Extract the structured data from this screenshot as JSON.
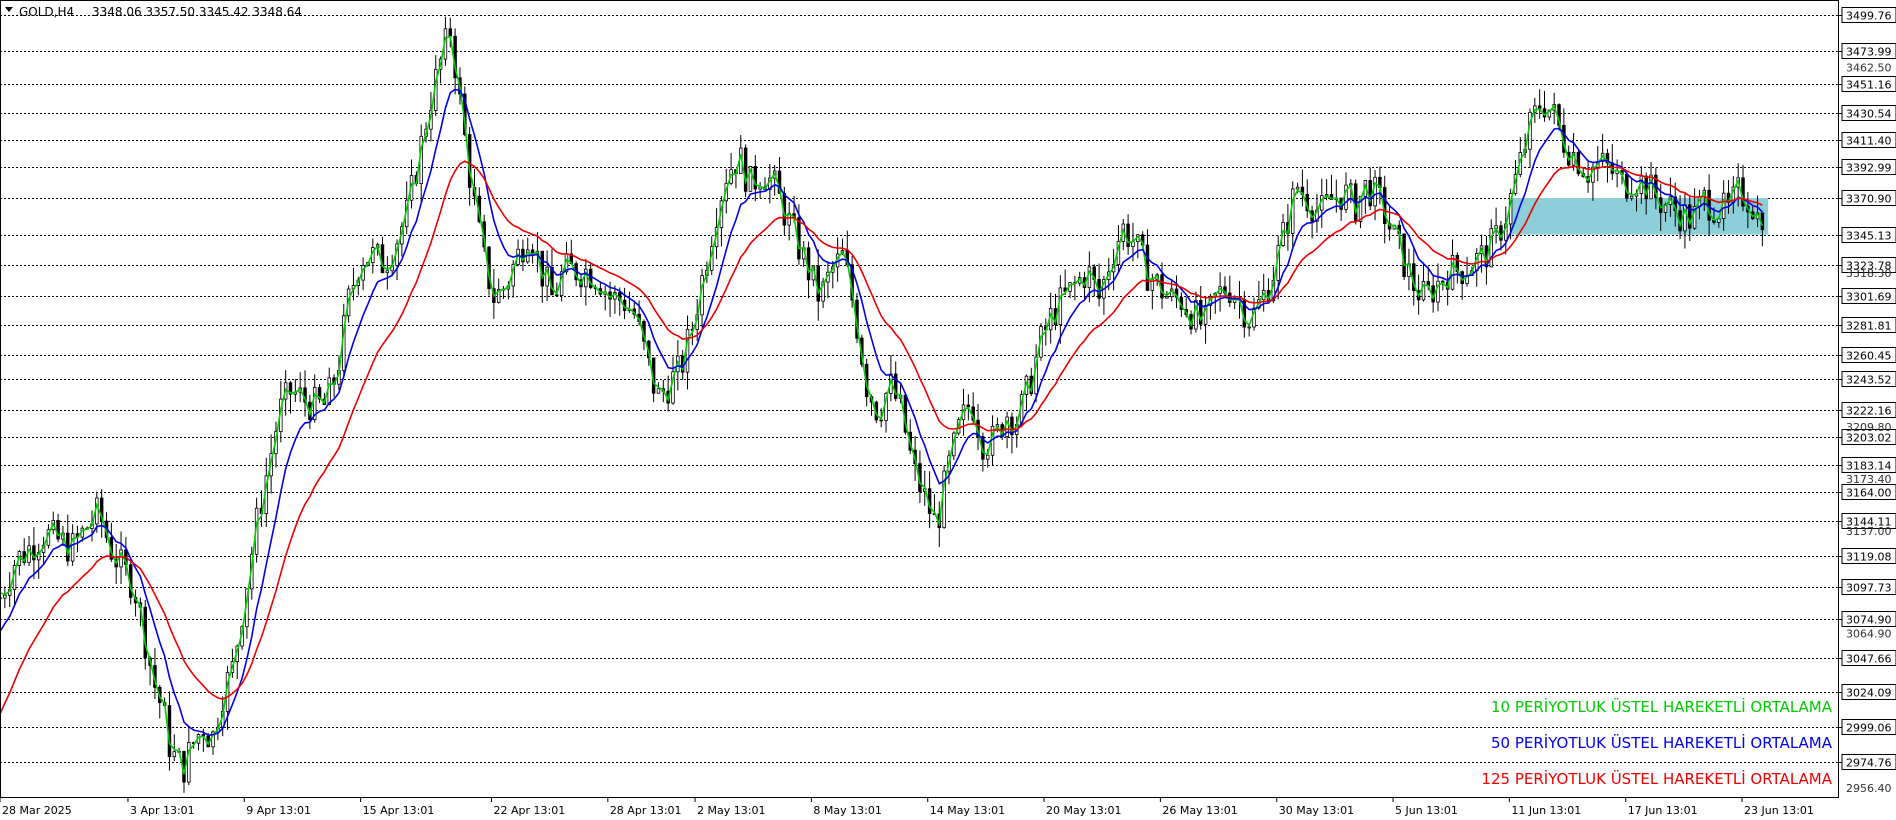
{
  "header": {
    "symbol": "GOLD,H4",
    "ohlc": "3348.06 3357.50 3345.42 3348.64"
  },
  "legend": [
    {
      "label": "10 PERİYOTLUK ÜSTEL HAREKETLİ ORTALAMA",
      "color": "#00cc00"
    },
    {
      "label": "50 PERİYOTLUK ÜSTEL HAREKETLİ ORTALAMA",
      "color": "#0000ee"
    },
    {
      "label": "125 PERİYOTLUK ÜSTEL HAREKETLİ ORTALAMA",
      "color": "#ee0000"
    }
  ],
  "colors": {
    "candle": "#000000",
    "grid": "#000000",
    "zone_fill": "#8ccfd8",
    "ema10": "#00cc00",
    "ema50": "#0000ee",
    "ema125": "#ee0000",
    "price_label_fill": "#ffffff"
  },
  "chart_data": {
    "type": "candlestick",
    "instrument": "GOLD",
    "timeframe": "H4",
    "ylim": [
      2950,
      3510
    ],
    "price_levels": [
      3499.76,
      3473.99,
      3451.16,
      3430.54,
      3411.4,
      3392.99,
      3370.9,
      3345.13,
      3323.78,
      3301.69,
      3281.81,
      3260.45,
      3243.52,
      3222.16,
      3203.02,
      3183.14,
      3164.0,
      3144.11,
      3119.08,
      3097.73,
      3074.9,
      3047.66,
      3024.09,
      2999.06,
      2974.76
    ],
    "minor_price_labels": [
      3462.5,
      3318.3,
      3209.8,
      3173.4,
      3137.0,
      3064.9,
      2956.4
    ],
    "x_tick_labels": [
      {
        "label": "28 Mar 2025",
        "t": 0
      },
      {
        "label": "3 Apr 13:01",
        "t": 4.4
      },
      {
        "label": "9 Apr 13:01",
        "t": 8.4
      },
      {
        "label": "15 Apr 13:01",
        "t": 12.4
      },
      {
        "label": "22 Apr 13:01",
        "t": 16.9
      },
      {
        "label": "28 Apr 13:01",
        "t": 20.9
      },
      {
        "label": "2 May 13:01",
        "t": 23.9
      },
      {
        "label": "8 May 13:01",
        "t": 27.9
      },
      {
        "label": "14 May 13:01",
        "t": 31.9
      },
      {
        "label": "20 May 13:01",
        "t": 35.9
      },
      {
        "label": "26 May 13:01",
        "t": 39.9
      },
      {
        "label": "30 May 13:01",
        "t": 43.9
      },
      {
        "label": "5 Jun 13:01",
        "t": 47.9
      },
      {
        "label": "11 Jun 13:01",
        "t": 51.9
      },
      {
        "label": "17 Jun 13:01",
        "t": 55.9
      },
      {
        "label": "23 Jun 13:01",
        "t": 59.9
      }
    ],
    "t_range": [
      0,
      63.2
    ],
    "zone": {
      "t_start": 51.9,
      "t_end": 60.8,
      "top": 3370.9,
      "bottom": 3345.13
    },
    "price_path": [
      [
        0,
        3090
      ],
      [
        0.5,
        3115
      ],
      [
        1,
        3125
      ],
      [
        1.5,
        3135
      ],
      [
        2,
        3130
      ],
      [
        2.5,
        3125
      ],
      [
        3,
        3140
      ],
      [
        3.4,
        3150
      ],
      [
        3.8,
        3125
      ],
      [
        4.2,
        3110
      ],
      [
        4.6,
        3100
      ],
      [
        5,
        3060
      ],
      [
        5.3,
        3030
      ],
      [
        5.6,
        3010
      ],
      [
        5.9,
        2980
      ],
      [
        6.3,
        2970
      ],
      [
        6.7,
        2990
      ],
      [
        7,
        3000
      ],
      [
        7.3,
        2990
      ],
      [
        7.6,
        3020
      ],
      [
        8,
        3040
      ],
      [
        8.4,
        3090
      ],
      [
        8.8,
        3140
      ],
      [
        9.2,
        3180
      ],
      [
        9.6,
        3220
      ],
      [
        10,
        3235
      ],
      [
        10.4,
        3230
      ],
      [
        10.8,
        3225
      ],
      [
        11.2,
        3225
      ],
      [
        11.6,
        3250
      ],
      [
        12,
        3300
      ],
      [
        12.4,
        3330
      ],
      [
        12.8,
        3330
      ],
      [
        13.2,
        3325
      ],
      [
        13.6,
        3340
      ],
      [
        14,
        3360
      ],
      [
        14.4,
        3400
      ],
      [
        14.8,
        3440
      ],
      [
        15.2,
        3470
      ],
      [
        15.5,
        3490
      ],
      [
        15.8,
        3440
      ],
      [
        16.2,
        3380
      ],
      [
        16.6,
        3330
      ],
      [
        17,
        3300
      ],
      [
        17.4,
        3310
      ],
      [
        17.8,
        3330
      ],
      [
        18.2,
        3350
      ],
      [
        18.6,
        3320
      ],
      [
        19,
        3300
      ],
      [
        19.4,
        3320
      ],
      [
        19.8,
        3320
      ],
      [
        20.2,
        3320
      ],
      [
        20.6,
        3315
      ],
      [
        21,
        3300
      ],
      [
        21.4,
        3300
      ],
      [
        21.8,
        3290
      ],
      [
        22.2,
        3260
      ],
      [
        22.6,
        3230
      ],
      [
        23,
        3240
      ],
      [
        23.4,
        3250
      ],
      [
        23.8,
        3280
      ],
      [
        24.2,
        3320
      ],
      [
        24.6,
        3360
      ],
      [
        25,
        3390
      ],
      [
        25.4,
        3400
      ],
      [
        25.8,
        3380
      ],
      [
        26.2,
        3390
      ],
      [
        26.6,
        3380
      ],
      [
        27,
        3360
      ],
      [
        27.4,
        3340
      ],
      [
        27.8,
        3320
      ],
      [
        28.2,
        3300
      ],
      [
        28.6,
        3320
      ],
      [
        29,
        3330
      ],
      [
        29.4,
        3290
      ],
      [
        29.8,
        3240
      ],
      [
        30.2,
        3220
      ],
      [
        30.6,
        3240
      ],
      [
        31,
        3220
      ],
      [
        31.4,
        3180
      ],
      [
        31.8,
        3160
      ],
      [
        32.2,
        3140
      ],
      [
        32.6,
        3180
      ],
      [
        33,
        3210
      ],
      [
        33.4,
        3230
      ],
      [
        33.8,
        3200
      ],
      [
        34.2,
        3200
      ],
      [
        34.6,
        3220
      ],
      [
        35,
        3215
      ],
      [
        35.4,
        3240
      ],
      [
        35.8,
        3270
      ],
      [
        36.2,
        3290
      ],
      [
        36.6,
        3300
      ],
      [
        37,
        3310
      ],
      [
        37.4,
        3320
      ],
      [
        37.8,
        3300
      ],
      [
        38.2,
        3330
      ],
      [
        38.6,
        3350
      ],
      [
        39,
        3340
      ],
      [
        39.4,
        3320
      ],
      [
        39.8,
        3310
      ],
      [
        40.2,
        3300
      ],
      [
        40.6,
        3300
      ],
      [
        41,
        3290
      ],
      [
        41.4,
        3280
      ],
      [
        41.8,
        3300
      ],
      [
        42.2,
        3310
      ],
      [
        42.6,
        3300
      ],
      [
        43,
        3285
      ],
      [
        43.4,
        3300
      ],
      [
        43.8,
        3320
      ],
      [
        44.2,
        3350
      ],
      [
        44.6,
        3380
      ],
      [
        45,
        3370
      ],
      [
        45.4,
        3360
      ],
      [
        45.8,
        3370
      ],
      [
        46.2,
        3375
      ],
      [
        46.6,
        3365
      ],
      [
        47,
        3380
      ],
      [
        47.4,
        3370
      ],
      [
        47.8,
        3350
      ],
      [
        48.2,
        3330
      ],
      [
        48.6,
        3310
      ],
      [
        49,
        3300
      ],
      [
        49.4,
        3310
      ],
      [
        49.8,
        3320
      ],
      [
        50.2,
        3320
      ],
      [
        50.6,
        3325
      ],
      [
        51,
        3330
      ],
      [
        51.4,
        3340
      ],
      [
        51.8,
        3360
      ],
      [
        52.2,
        3390
      ],
      [
        52.6,
        3420
      ],
      [
        53,
        3440
      ],
      [
        53.4,
        3430
      ],
      [
        53.8,
        3410
      ],
      [
        54.2,
        3400
      ],
      [
        54.6,
        3390
      ],
      [
        55,
        3395
      ],
      [
        55.4,
        3390
      ],
      [
        55.8,
        3380
      ],
      [
        56.2,
        3385
      ],
      [
        56.6,
        3380
      ],
      [
        57,
        3370
      ],
      [
        57.4,
        3365
      ],
      [
        57.8,
        3360
      ],
      [
        58.2,
        3355
      ],
      [
        58.6,
        3370
      ],
      [
        59,
        3365
      ],
      [
        59.4,
        3360
      ],
      [
        59.8,
        3375
      ],
      [
        60.2,
        3370
      ],
      [
        60.6,
        3348.64
      ]
    ],
    "series": [
      {
        "name": "10 PERİYOTLUK ÜSTEL HAREKETLİ ORTALAMA",
        "period": 10
      },
      {
        "name": "50 PERİYOTLUK ÜSTEL HAREKETLİ ORTALAMA",
        "period": 50
      },
      {
        "name": "125 PERİYOTLUK ÜSTEL HAREKETLİ ORTALAMA",
        "period": 125
      }
    ]
  }
}
